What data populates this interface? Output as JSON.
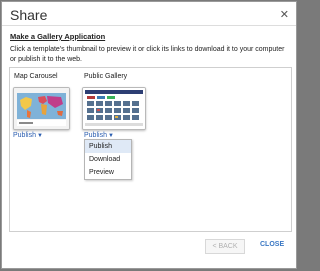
{
  "dialog": {
    "title": "Share",
    "subtitle": "Make a Gallery Application",
    "description": "Click a template's thumbnail to preview it or click its links to download it to your computer or publish it to the web.",
    "templates": [
      {
        "name": "Map Carousel",
        "publish_label": "Publish"
      },
      {
        "name": "Public Gallery",
        "publish_label": "Publish"
      }
    ],
    "menu_items": [
      "Publish",
      "Download",
      "Preview"
    ],
    "back_label": "< BACK",
    "close_label": "CLOSE"
  }
}
